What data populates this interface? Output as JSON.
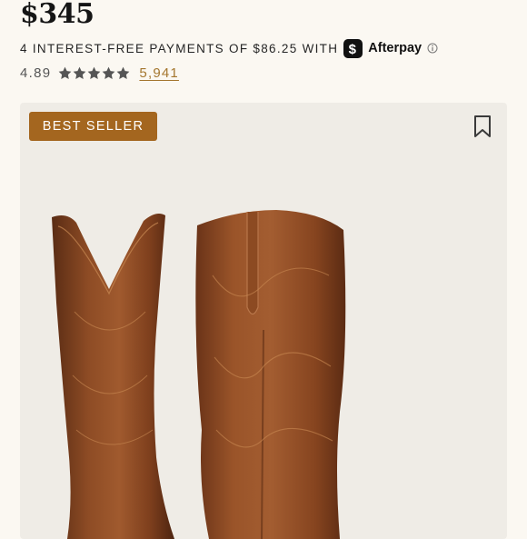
{
  "product": {
    "price": "$345",
    "payments_text": "4 INTEREST-FREE PAYMENTS OF $86.25 WITH",
    "payment_provider": "Afterpay",
    "rating_value": "4.89",
    "rating_stars": 5,
    "review_count": "5,941",
    "badge_label": "BEST SELLER"
  },
  "icons": {
    "afterpay": "afterpay-logo",
    "info": "info-icon",
    "star": "star-icon",
    "bookmark": "bookmark-icon"
  },
  "colors": {
    "page_background": "#fbf8f2",
    "card_background": "#efece6",
    "badge_background": "#a4661f",
    "review_link": "#a4762e",
    "star_color": "#555555",
    "leather": "#8a4a25"
  }
}
